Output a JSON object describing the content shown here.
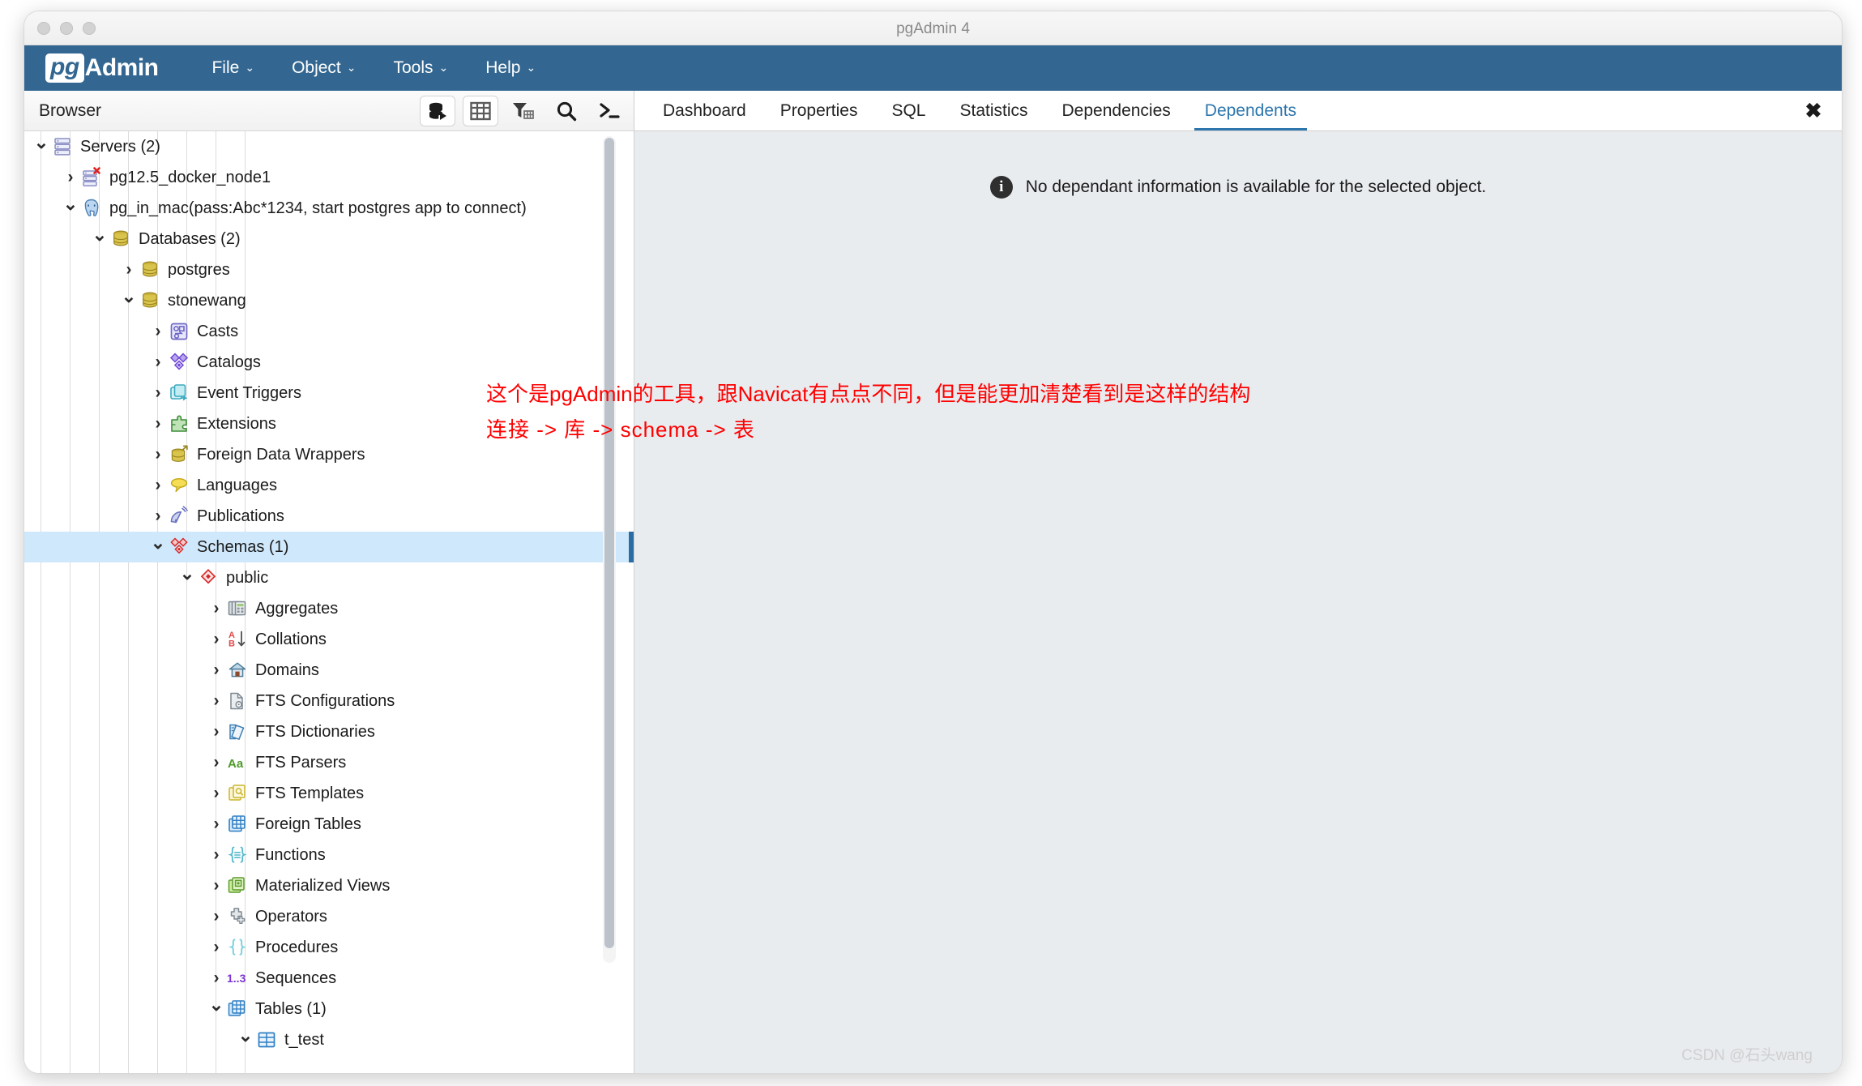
{
  "window": {
    "title": "pgAdmin 4"
  },
  "navbar": {
    "logo_pg": "pg",
    "logo_admin": "Admin",
    "menus": [
      {
        "label": "File",
        "caret": "⌄"
      },
      {
        "label": "Object",
        "caret": "⌄"
      },
      {
        "label": "Tools",
        "caret": "⌄"
      },
      {
        "label": "Help",
        "caret": "⌄"
      }
    ]
  },
  "browser": {
    "title": "Browser",
    "tools": [
      {
        "name": "add-server-icon",
        "title": "Add New Server"
      },
      {
        "name": "view-data-grid-icon",
        "title": "View Data"
      },
      {
        "name": "filter-table-icon",
        "title": "Filtered Rows"
      },
      {
        "name": "search-icon",
        "title": "Search Objects"
      },
      {
        "name": "psql-terminal-icon",
        "title": "PSQL Tool"
      }
    ]
  },
  "tree": [
    {
      "label": "Servers (2)",
      "depth": 0,
      "state": "open",
      "icon": "servers-icon",
      "selected": false
    },
    {
      "label": "pg12.5_docker_node1",
      "depth": 1,
      "state": "closed",
      "icon": "server-disconnected-icon",
      "selected": false
    },
    {
      "label": "pg_in_mac(pass:Abc*1234, start postgres app to connect)",
      "depth": 1,
      "state": "open",
      "icon": "server-postgres-icon",
      "selected": false
    },
    {
      "label": "Databases (2)",
      "depth": 2,
      "state": "open",
      "icon": "databases-icon",
      "selected": false
    },
    {
      "label": "postgres",
      "depth": 3,
      "state": "closed",
      "icon": "database-icon",
      "selected": false
    },
    {
      "label": "stonewang",
      "depth": 3,
      "state": "open",
      "icon": "database-icon",
      "selected": false
    },
    {
      "label": "Casts",
      "depth": 4,
      "state": "closed",
      "icon": "casts-icon",
      "selected": false
    },
    {
      "label": "Catalogs",
      "depth": 4,
      "state": "closed",
      "icon": "catalogs-icon",
      "selected": false
    },
    {
      "label": "Event Triggers",
      "depth": 4,
      "state": "closed",
      "icon": "event-triggers-icon",
      "selected": false
    },
    {
      "label": "Extensions",
      "depth": 4,
      "state": "closed",
      "icon": "extensions-icon",
      "selected": false
    },
    {
      "label": "Foreign Data Wrappers",
      "depth": 4,
      "state": "closed",
      "icon": "foreign-data-wrappers-icon",
      "selected": false
    },
    {
      "label": "Languages",
      "depth": 4,
      "state": "closed",
      "icon": "languages-icon",
      "selected": false
    },
    {
      "label": "Publications",
      "depth": 4,
      "state": "closed",
      "icon": "publications-icon",
      "selected": false
    },
    {
      "label": "Schemas (1)",
      "depth": 4,
      "state": "open",
      "icon": "schemas-icon",
      "selected": true
    },
    {
      "label": "public",
      "depth": 5,
      "state": "open",
      "icon": "schema-icon",
      "selected": false
    },
    {
      "label": "Aggregates",
      "depth": 6,
      "state": "closed",
      "icon": "aggregates-icon",
      "selected": false
    },
    {
      "label": "Collations",
      "depth": 6,
      "state": "closed",
      "icon": "collations-icon",
      "selected": false
    },
    {
      "label": "Domains",
      "depth": 6,
      "state": "closed",
      "icon": "domains-icon",
      "selected": false
    },
    {
      "label": "FTS Configurations",
      "depth": 6,
      "state": "closed",
      "icon": "fts-configurations-icon",
      "selected": false
    },
    {
      "label": "FTS Dictionaries",
      "depth": 6,
      "state": "closed",
      "icon": "fts-dictionaries-icon",
      "selected": false
    },
    {
      "label": "FTS Parsers",
      "depth": 6,
      "state": "closed",
      "icon": "fts-parsers-icon",
      "selected": false
    },
    {
      "label": "FTS Templates",
      "depth": 6,
      "state": "closed",
      "icon": "fts-templates-icon",
      "selected": false
    },
    {
      "label": "Foreign Tables",
      "depth": 6,
      "state": "closed",
      "icon": "foreign-tables-icon",
      "selected": false
    },
    {
      "label": "Functions",
      "depth": 6,
      "state": "closed",
      "icon": "functions-icon",
      "selected": false
    },
    {
      "label": "Materialized Views",
      "depth": 6,
      "state": "closed",
      "icon": "materialized-views-icon",
      "selected": false
    },
    {
      "label": "Operators",
      "depth": 6,
      "state": "closed",
      "icon": "operators-icon",
      "selected": false
    },
    {
      "label": "Procedures",
      "depth": 6,
      "state": "closed",
      "icon": "procedures-icon",
      "selected": false
    },
    {
      "label": "Sequences",
      "depth": 6,
      "state": "closed",
      "icon": "sequences-icon",
      "selected": false
    },
    {
      "label": "Tables (1)",
      "depth": 6,
      "state": "open",
      "icon": "tables-icon",
      "selected": false
    },
    {
      "label": "t_test",
      "depth": 7,
      "state": "open",
      "icon": "table-icon",
      "selected": false
    }
  ],
  "tabs": [
    {
      "label": "Dashboard",
      "active": false
    },
    {
      "label": "Properties",
      "active": false
    },
    {
      "label": "SQL",
      "active": false
    },
    {
      "label": "Statistics",
      "active": false
    },
    {
      "label": "Dependencies",
      "active": false
    },
    {
      "label": "Dependents",
      "active": true
    }
  ],
  "tab_close_glyph": "✖",
  "panel": {
    "info_glyph": "i",
    "message": "No dependant information is available for the selected object."
  },
  "annotation": {
    "line1": "这个是pgAdmin的工具，跟Navicat有点点不同，但是能更加清楚看到是这样的结构",
    "line2": "连接 -> 库 -> schema -> 表"
  },
  "watermark": "CSDN @石头wang",
  "colors": {
    "navbar": "#336791",
    "accent": "#2d76ad",
    "selection": "#cfe8fb",
    "selection_marker": "#2b6ca3",
    "panel_bg": "#e9ecef",
    "annotation": "#ff0000"
  }
}
